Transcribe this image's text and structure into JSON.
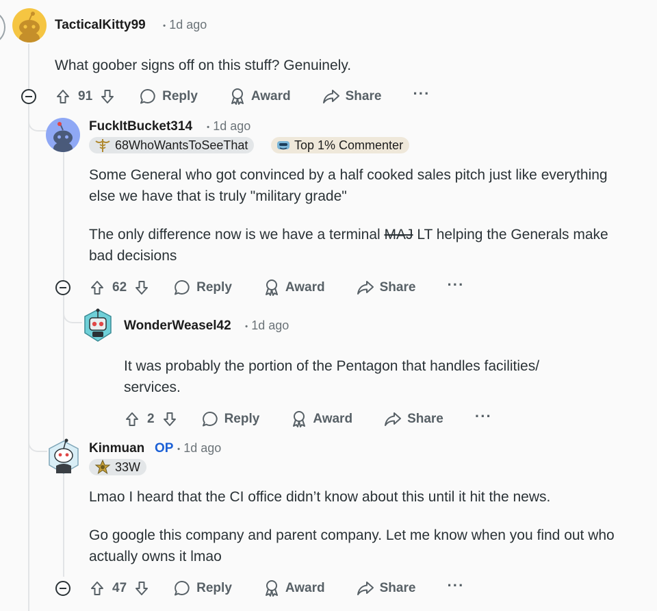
{
  "actions": {
    "reply": "Reply",
    "award": "Award",
    "share": "Share",
    "more": "···"
  },
  "comments": [
    {
      "author": "TacticalKitty99",
      "separator": "•",
      "time": "1d ago",
      "body": [
        "What goober signs off on this stuff? Genuinely."
      ],
      "votes": "91"
    },
    {
      "author": "FuckItBucket314",
      "separator": "•",
      "time": "1d ago",
      "flair": "68WhoWantsToSeeThat",
      "badge": "Top 1% Commenter",
      "body_p1": "Some General who got convinced by a half cooked sales pitch just like everything else we have that is truly \"military grade\"",
      "body_p2_a": "The only difference now is we have a terminal ",
      "body_p2_strike": "MAJ",
      "body_p2_b": " LT helping the Generals make bad decisions",
      "votes": "62"
    },
    {
      "author": "WonderWeasel42",
      "separator": "•",
      "time": "1d ago",
      "body": [
        "It was probably the portion of the Pentagon that handles facilities/ services."
      ],
      "votes": "2"
    },
    {
      "author": "Kinmuan",
      "op": "OP",
      "separator": "•",
      "time": "1d ago",
      "flair": "33W",
      "body_p1": "Lmao I heard that the CI office didn’t know about this until it hit the news.",
      "body_p2": "Go google this company and parent company. Let me know when you find out who actually owns it lmao",
      "votes": "47"
    }
  ],
  "colors": {
    "text": "#2a3236",
    "muted": "#576066",
    "op": "#1b60d6",
    "thread": "#e2e4e6"
  }
}
